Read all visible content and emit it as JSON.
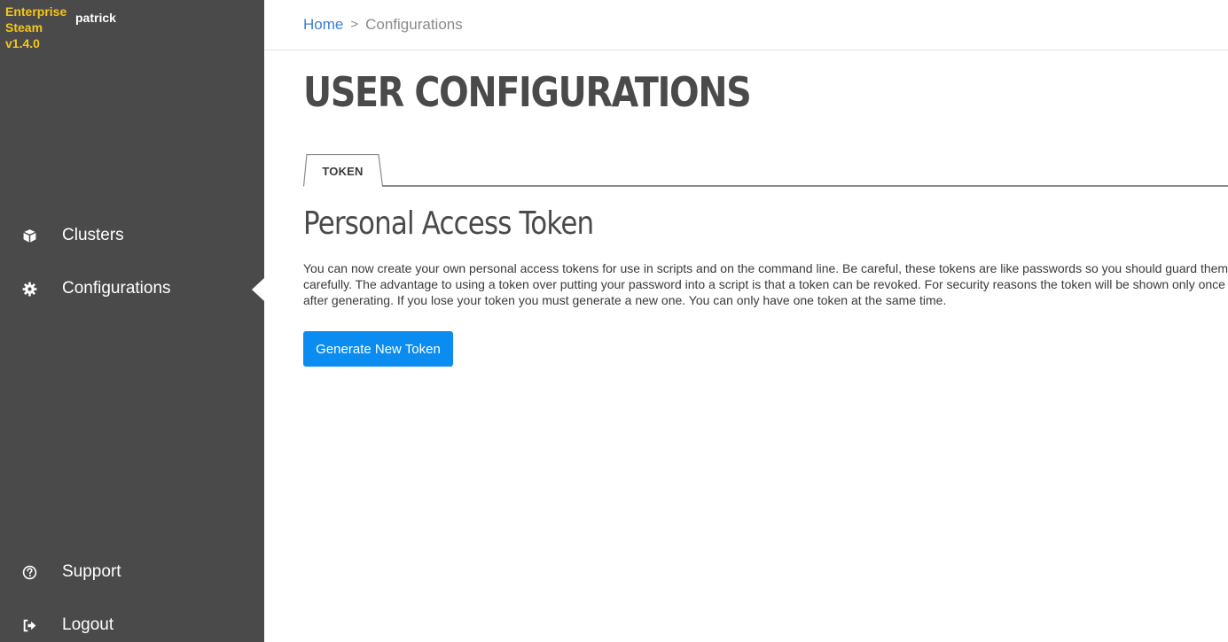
{
  "sidebar": {
    "brand": {
      "line1": "Enterprise",
      "line2": "Steam",
      "version": "v1.4.0"
    },
    "username": "patrick",
    "items": [
      {
        "label": "Clusters",
        "icon": "cube-icon"
      },
      {
        "label": "Configurations",
        "icon": "gear-icon",
        "active": true
      },
      {
        "label": "Support",
        "icon": "question-circle-icon"
      },
      {
        "label": "Logout",
        "icon": "logout-icon"
      }
    ]
  },
  "breadcrumb": {
    "home": "Home",
    "separator": ">",
    "current": "Configurations"
  },
  "main": {
    "title": "USER CONFIGURATIONS",
    "tabs": [
      {
        "label": "TOKEN",
        "active": true
      }
    ],
    "section_title": "Personal Access Token",
    "description": "You can now create your own personal access tokens for use in scripts and on the command line. Be careful, these tokens are like passwords so you should guard them carefully. The advantage to using a token over putting your password into a script is that a token can be revoked. For security reasons the token will be shown only once after generating. If you lose your token you must generate a new one. You can only have one token at the same time.",
    "generate_button": "Generate New Token"
  },
  "colors": {
    "sidebar_bg": "#4a4a4a",
    "brand": "#f5c518",
    "link": "#3a7fd0",
    "button": "#0a8cf0",
    "text_dark": "#4a4a4a"
  }
}
